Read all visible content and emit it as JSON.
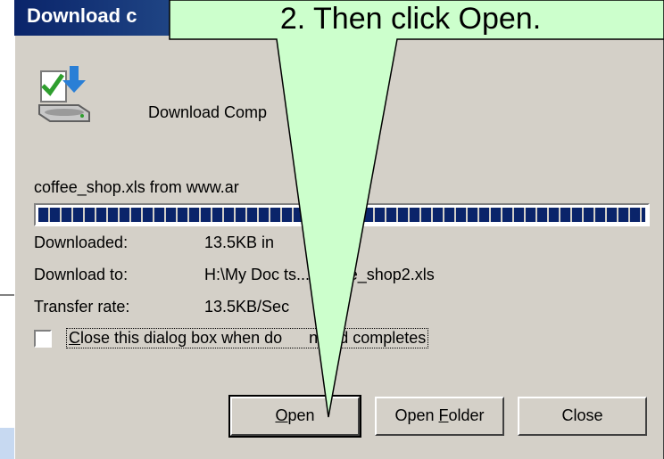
{
  "dialog": {
    "title": "Download c",
    "status": "Download Comp",
    "file_line": "coffee_shop.xls from www.ar",
    "progress": 1.0,
    "info": [
      {
        "label": "Downloaded:",
        "value": "13.5KB in"
      },
      {
        "label": "Download to:",
        "value": "H:\\My Doc         ts...\\coffee_shop2.xls"
      },
      {
        "label": "Transfer rate:",
        "value": "13.5KB/Sec"
      }
    ],
    "checkbox_label": "Close this dialog box when do      nload completes",
    "checkbox_checked": false,
    "buttons": {
      "open": "Open",
      "open_folder": "Open Folder",
      "close": "Close"
    }
  },
  "callout": {
    "text": "2. Then click Open.",
    "fill_color": "#ccffcc"
  },
  "icons": {
    "download_icon": "download-complete-icon"
  }
}
